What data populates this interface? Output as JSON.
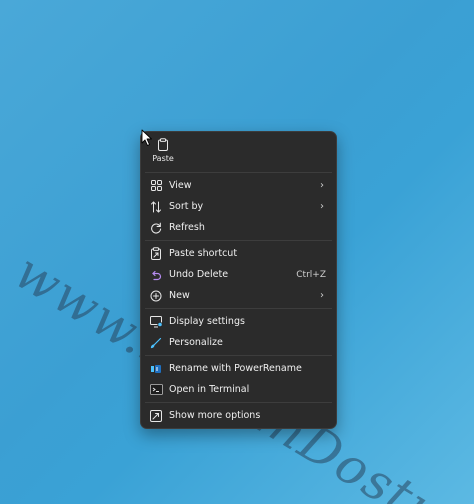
{
  "watermark": "www.SistemDostu.com",
  "colors": {
    "menu_bg": "#2b2b2b",
    "desktop_bg": "#3b9fd3",
    "accent": "#4cc2ff"
  },
  "menu": {
    "top_actions": [
      {
        "label": "Paste",
        "icon": "clipboard-icon"
      }
    ],
    "groups": [
      [
        {
          "label": "View",
          "icon": "grid-icon",
          "submenu": true
        },
        {
          "label": "Sort by",
          "icon": "sort-arrows-icon",
          "submenu": true
        },
        {
          "label": "Refresh",
          "icon": "refresh-icon"
        }
      ],
      [
        {
          "label": "Paste shortcut",
          "icon": "paste-shortcut-icon"
        },
        {
          "label": "Undo Delete",
          "icon": "undo-icon",
          "shortcut": "Ctrl+Z"
        },
        {
          "label": "New",
          "icon": "plus-circle-icon",
          "submenu": true
        }
      ],
      [
        {
          "label": "Display settings",
          "icon": "display-icon"
        },
        {
          "label": "Personalize",
          "icon": "brush-icon"
        }
      ],
      [
        {
          "label": "Rename with PowerRename",
          "icon": "powerrename-icon"
        },
        {
          "label": "Open in Terminal",
          "icon": "terminal-icon"
        }
      ],
      [
        {
          "label": "Show more options",
          "icon": "more-options-icon"
        }
      ]
    ]
  }
}
